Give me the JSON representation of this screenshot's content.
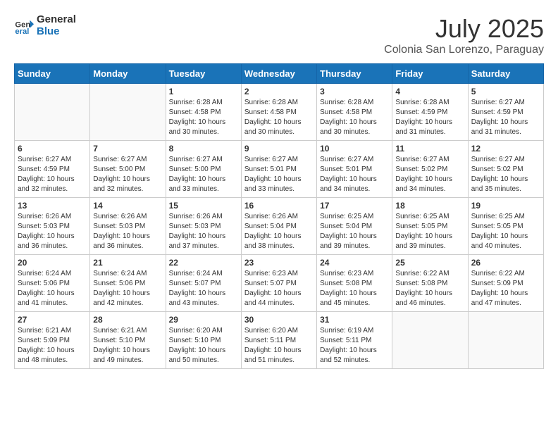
{
  "header": {
    "logo_line1": "General",
    "logo_line2": "Blue",
    "month_year": "July 2025",
    "subtitle": "Colonia San Lorenzo, Paraguay"
  },
  "days_of_week": [
    "Sunday",
    "Monday",
    "Tuesday",
    "Wednesday",
    "Thursday",
    "Friday",
    "Saturday"
  ],
  "weeks": [
    [
      {
        "day": "",
        "sunrise": "",
        "sunset": "",
        "daylight": ""
      },
      {
        "day": "",
        "sunrise": "",
        "sunset": "",
        "daylight": ""
      },
      {
        "day": "1",
        "sunrise": "Sunrise: 6:28 AM",
        "sunset": "Sunset: 4:58 PM",
        "daylight": "Daylight: 10 hours and 30 minutes."
      },
      {
        "day": "2",
        "sunrise": "Sunrise: 6:28 AM",
        "sunset": "Sunset: 4:58 PM",
        "daylight": "Daylight: 10 hours and 30 minutes."
      },
      {
        "day": "3",
        "sunrise": "Sunrise: 6:28 AM",
        "sunset": "Sunset: 4:58 PM",
        "daylight": "Daylight: 10 hours and 30 minutes."
      },
      {
        "day": "4",
        "sunrise": "Sunrise: 6:28 AM",
        "sunset": "Sunset: 4:59 PM",
        "daylight": "Daylight: 10 hours and 31 minutes."
      },
      {
        "day": "5",
        "sunrise": "Sunrise: 6:27 AM",
        "sunset": "Sunset: 4:59 PM",
        "daylight": "Daylight: 10 hours and 31 minutes."
      }
    ],
    [
      {
        "day": "6",
        "sunrise": "Sunrise: 6:27 AM",
        "sunset": "Sunset: 4:59 PM",
        "daylight": "Daylight: 10 hours and 32 minutes."
      },
      {
        "day": "7",
        "sunrise": "Sunrise: 6:27 AM",
        "sunset": "Sunset: 5:00 PM",
        "daylight": "Daylight: 10 hours and 32 minutes."
      },
      {
        "day": "8",
        "sunrise": "Sunrise: 6:27 AM",
        "sunset": "Sunset: 5:00 PM",
        "daylight": "Daylight: 10 hours and 33 minutes."
      },
      {
        "day": "9",
        "sunrise": "Sunrise: 6:27 AM",
        "sunset": "Sunset: 5:01 PM",
        "daylight": "Daylight: 10 hours and 33 minutes."
      },
      {
        "day": "10",
        "sunrise": "Sunrise: 6:27 AM",
        "sunset": "Sunset: 5:01 PM",
        "daylight": "Daylight: 10 hours and 34 minutes."
      },
      {
        "day": "11",
        "sunrise": "Sunrise: 6:27 AM",
        "sunset": "Sunset: 5:02 PM",
        "daylight": "Daylight: 10 hours and 34 minutes."
      },
      {
        "day": "12",
        "sunrise": "Sunrise: 6:27 AM",
        "sunset": "Sunset: 5:02 PM",
        "daylight": "Daylight: 10 hours and 35 minutes."
      }
    ],
    [
      {
        "day": "13",
        "sunrise": "Sunrise: 6:26 AM",
        "sunset": "Sunset: 5:03 PM",
        "daylight": "Daylight: 10 hours and 36 minutes."
      },
      {
        "day": "14",
        "sunrise": "Sunrise: 6:26 AM",
        "sunset": "Sunset: 5:03 PM",
        "daylight": "Daylight: 10 hours and 36 minutes."
      },
      {
        "day": "15",
        "sunrise": "Sunrise: 6:26 AM",
        "sunset": "Sunset: 5:03 PM",
        "daylight": "Daylight: 10 hours and 37 minutes."
      },
      {
        "day": "16",
        "sunrise": "Sunrise: 6:26 AM",
        "sunset": "Sunset: 5:04 PM",
        "daylight": "Daylight: 10 hours and 38 minutes."
      },
      {
        "day": "17",
        "sunrise": "Sunrise: 6:25 AM",
        "sunset": "Sunset: 5:04 PM",
        "daylight": "Daylight: 10 hours and 39 minutes."
      },
      {
        "day": "18",
        "sunrise": "Sunrise: 6:25 AM",
        "sunset": "Sunset: 5:05 PM",
        "daylight": "Daylight: 10 hours and 39 minutes."
      },
      {
        "day": "19",
        "sunrise": "Sunrise: 6:25 AM",
        "sunset": "Sunset: 5:05 PM",
        "daylight": "Daylight: 10 hours and 40 minutes."
      }
    ],
    [
      {
        "day": "20",
        "sunrise": "Sunrise: 6:24 AM",
        "sunset": "Sunset: 5:06 PM",
        "daylight": "Daylight: 10 hours and 41 minutes."
      },
      {
        "day": "21",
        "sunrise": "Sunrise: 6:24 AM",
        "sunset": "Sunset: 5:06 PM",
        "daylight": "Daylight: 10 hours and 42 minutes."
      },
      {
        "day": "22",
        "sunrise": "Sunrise: 6:24 AM",
        "sunset": "Sunset: 5:07 PM",
        "daylight": "Daylight: 10 hours and 43 minutes."
      },
      {
        "day": "23",
        "sunrise": "Sunrise: 6:23 AM",
        "sunset": "Sunset: 5:07 PM",
        "daylight": "Daylight: 10 hours and 44 minutes."
      },
      {
        "day": "24",
        "sunrise": "Sunrise: 6:23 AM",
        "sunset": "Sunset: 5:08 PM",
        "daylight": "Daylight: 10 hours and 45 minutes."
      },
      {
        "day": "25",
        "sunrise": "Sunrise: 6:22 AM",
        "sunset": "Sunset: 5:08 PM",
        "daylight": "Daylight: 10 hours and 46 minutes."
      },
      {
        "day": "26",
        "sunrise": "Sunrise: 6:22 AM",
        "sunset": "Sunset: 5:09 PM",
        "daylight": "Daylight: 10 hours and 47 minutes."
      }
    ],
    [
      {
        "day": "27",
        "sunrise": "Sunrise: 6:21 AM",
        "sunset": "Sunset: 5:09 PM",
        "daylight": "Daylight: 10 hours and 48 minutes."
      },
      {
        "day": "28",
        "sunrise": "Sunrise: 6:21 AM",
        "sunset": "Sunset: 5:10 PM",
        "daylight": "Daylight: 10 hours and 49 minutes."
      },
      {
        "day": "29",
        "sunrise": "Sunrise: 6:20 AM",
        "sunset": "Sunset: 5:10 PM",
        "daylight": "Daylight: 10 hours and 50 minutes."
      },
      {
        "day": "30",
        "sunrise": "Sunrise: 6:20 AM",
        "sunset": "Sunset: 5:11 PM",
        "daylight": "Daylight: 10 hours and 51 minutes."
      },
      {
        "day": "31",
        "sunrise": "Sunrise: 6:19 AM",
        "sunset": "Sunset: 5:11 PM",
        "daylight": "Daylight: 10 hours and 52 minutes."
      },
      {
        "day": "",
        "sunrise": "",
        "sunset": "",
        "daylight": ""
      },
      {
        "day": "",
        "sunrise": "",
        "sunset": "",
        "daylight": ""
      }
    ]
  ]
}
